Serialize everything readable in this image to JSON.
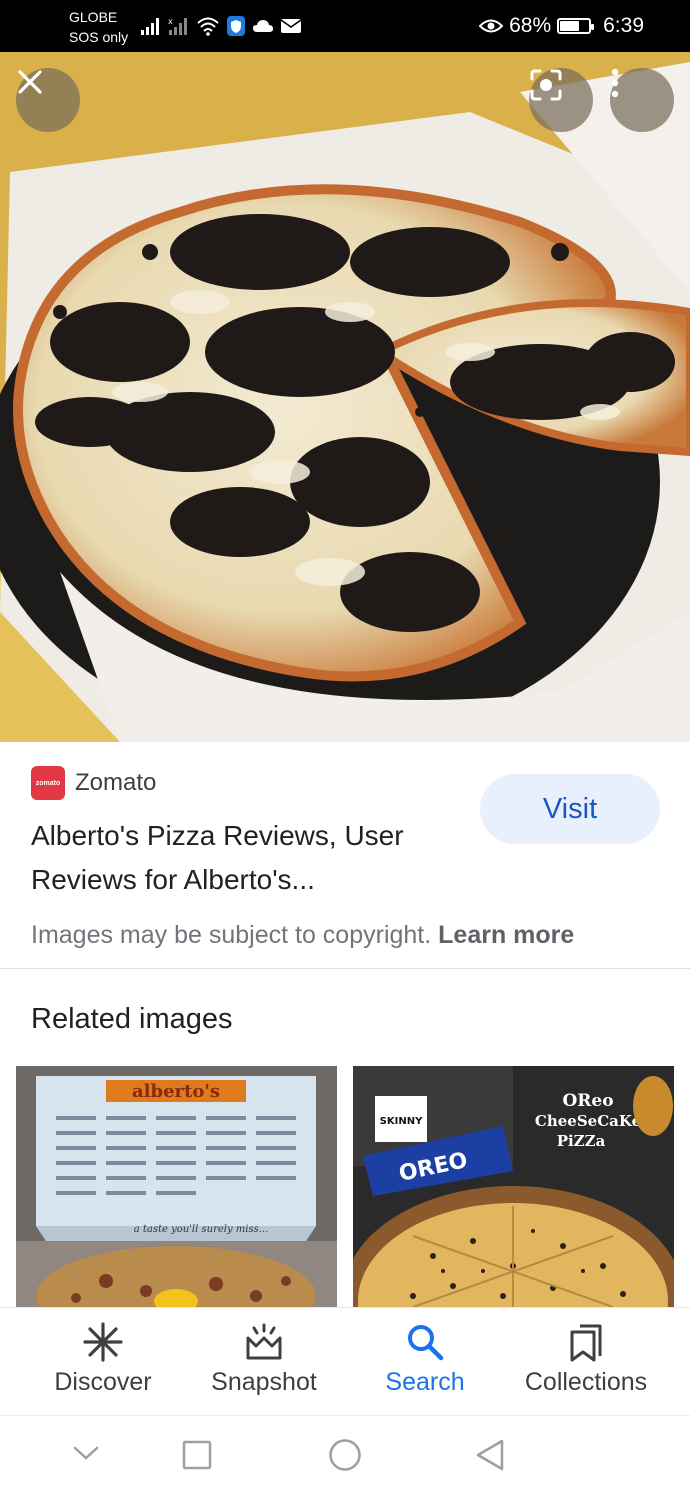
{
  "status_bar": {
    "carrier_line1": "GLOBE",
    "carrier_line2": "SOS only",
    "battery": "68%",
    "time": "6:39"
  },
  "source": {
    "name": "Zomato",
    "logo_text": "zomato",
    "title": "Alberto's Pizza Reviews, User Reviews for Alberto's...",
    "copyright_text": "Images may be subject to copyright.",
    "learn_more": "Learn more",
    "visit_label": "Visit"
  },
  "related": {
    "heading": "Related images",
    "items": [
      {
        "box_brand": "alberto's",
        "box_tagline": "a taste you'll surely miss..."
      },
      {
        "caption_line1": "OReo",
        "caption_line2": "CheeSeCaKe",
        "caption_line3": "PiZZa",
        "pack_label": "OREO",
        "badge": "SKINNY"
      }
    ]
  },
  "bottom_nav": {
    "items": [
      {
        "label": "Discover",
        "icon": "asterisk-icon"
      },
      {
        "label": "Snapshot",
        "icon": "snapshot-icon"
      },
      {
        "label": "Search",
        "icon": "search-icon"
      },
      {
        "label": "Collections",
        "icon": "collections-icon"
      }
    ],
    "active": "Search"
  },
  "colors": {
    "accent": "#1a73e8",
    "visit_bg": "#e8f0fe",
    "zomato_red": "#e23744"
  }
}
